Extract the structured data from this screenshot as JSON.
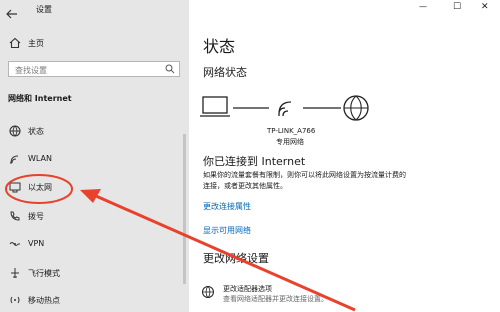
{
  "window": {
    "title": "设置",
    "minimize": "—",
    "maximize": "☐",
    "close": "✕"
  },
  "sidebar": {
    "back_icon": "back-arrow-icon",
    "home_label": "主页",
    "search_placeholder": "查找设置",
    "section_title": "网络和 Internet",
    "items": [
      {
        "label": "状态",
        "icon": "globe-status-icon"
      },
      {
        "label": "WLAN",
        "icon": "wifi-icon"
      },
      {
        "label": "以太网",
        "icon": "ethernet-icon"
      },
      {
        "label": "拨号",
        "icon": "phone-icon"
      },
      {
        "label": "VPN",
        "icon": "vpn-icon"
      },
      {
        "label": "飞行模式",
        "icon": "airplane-icon"
      },
      {
        "label": "移动热点",
        "icon": "hotspot-icon"
      }
    ]
  },
  "main": {
    "page_title": "状态",
    "network_status_heading": "网络状态",
    "network_name": "TP-LINK_A766",
    "network_type": "专用网络",
    "connected_heading": "你已连接到 Internet",
    "connected_desc_line1": "如果你的流量套餐有限制，则你可以将此网络设置为按流量计费的",
    "connected_desc_line2": "连接，或者更改其他属性。",
    "link_change_props": "更改连接属性",
    "link_show_networks": "显示可用网络",
    "change_settings_heading": "更改网络设置",
    "adapter_title": "更改适配器选项",
    "adapter_desc": "查看网络适配器并更改连接设置。"
  },
  "annotation_color": "#e8412c"
}
